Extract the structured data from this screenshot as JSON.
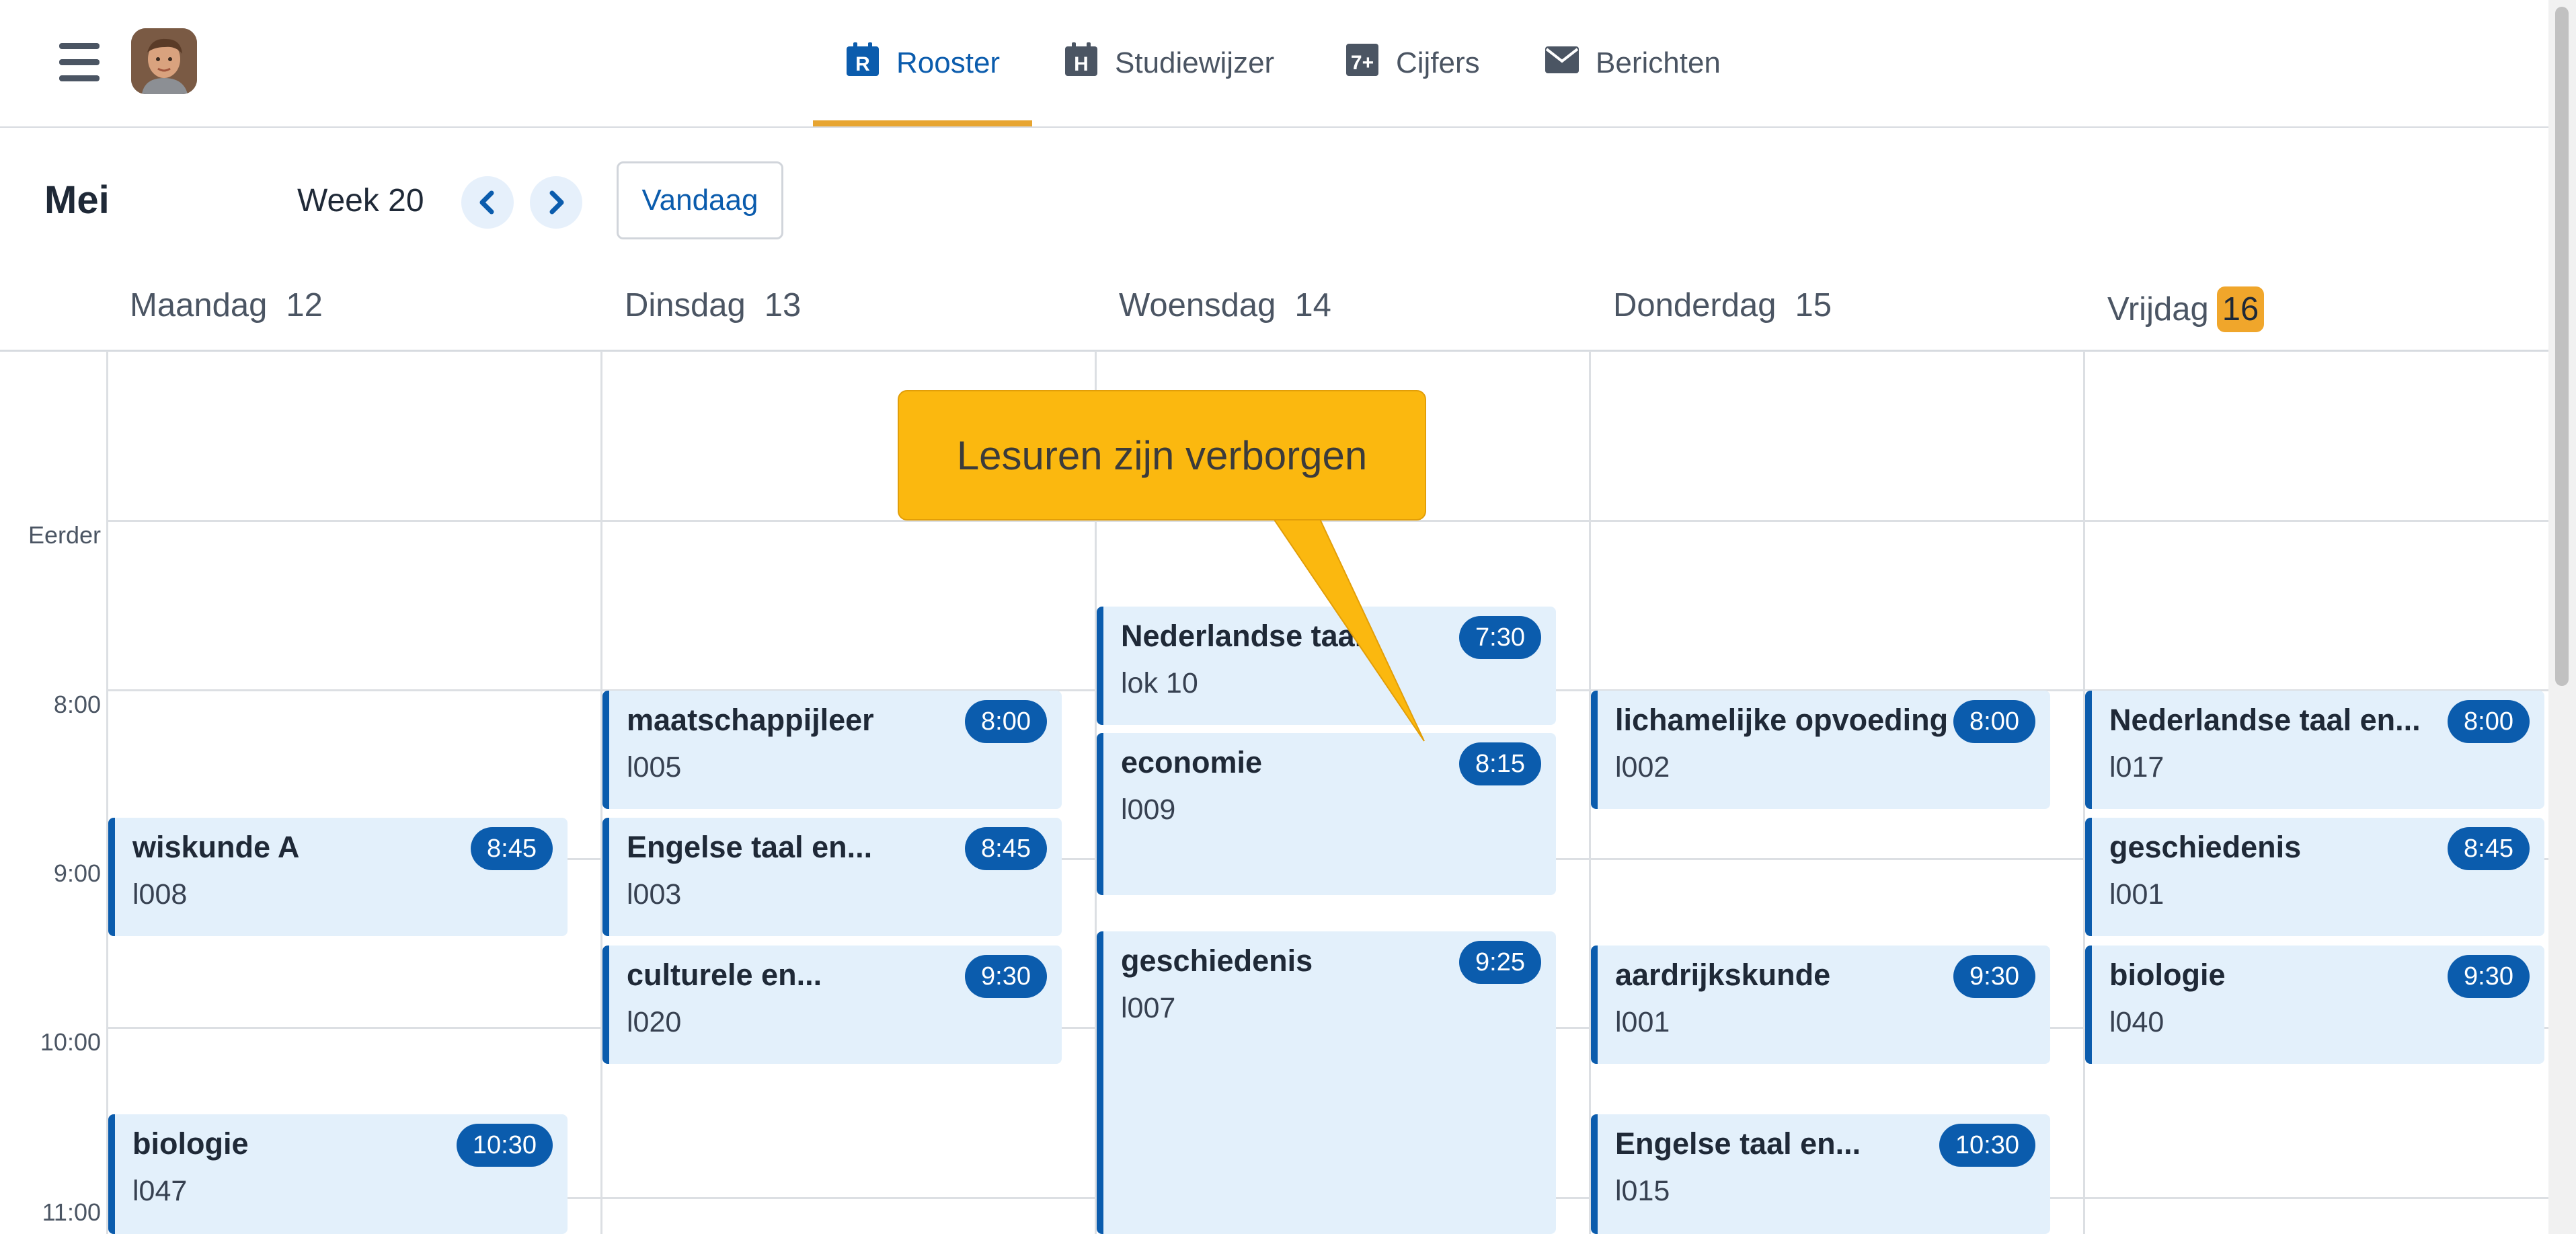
{
  "nav": {
    "tabs": [
      {
        "label": "Rooster",
        "icon": "rooster-icon",
        "active": true
      },
      {
        "label": "Studiewijzer",
        "icon": "studiewijzer-icon",
        "active": false
      },
      {
        "label": "Cijfers",
        "icon": "cijfers-icon",
        "active": false
      },
      {
        "label": "Berichten",
        "icon": "berichten-icon",
        "active": false
      }
    ],
    "rooster_icon_glyph": "R",
    "studiewijzer_icon_glyph": "H",
    "cijfers_icon_glyph": "7+"
  },
  "calendar": {
    "month": "Mei",
    "week": "Week 20",
    "today_button": "Vandaag",
    "days": [
      {
        "name": "Maandag",
        "num": "12"
      },
      {
        "name": "Dinsdag",
        "num": "13"
      },
      {
        "name": "Woensdag",
        "num": "14"
      },
      {
        "name": "Donderdag",
        "num": "15"
      },
      {
        "name": "Vrijdag",
        "num": "16",
        "today": true
      }
    ],
    "time_labels": [
      "Eerder",
      "8:00",
      "9:00",
      "10:00",
      "11:00"
    ],
    "lessons": {
      "mon": [
        {
          "subject": "wiskunde A",
          "room": "l008",
          "time": "8:45"
        },
        {
          "subject": "biologie",
          "room": "l047",
          "time": "10:30"
        }
      ],
      "tue": [
        {
          "subject": "maatschappijleer",
          "room": "l005",
          "time": "8:00"
        },
        {
          "subject": "Engelse taal en...",
          "room": "l003",
          "time": "8:45"
        },
        {
          "subject": "culturele en...",
          "room": "l020",
          "time": "9:30"
        }
      ],
      "wed": [
        {
          "subject": "Nederlandse taal",
          "room": "lok 10",
          "time": "7:30"
        },
        {
          "subject": "economie",
          "room": "l009",
          "time": "8:15"
        },
        {
          "subject": "geschiedenis",
          "room": "l007",
          "time": "9:25"
        }
      ],
      "thu": [
        {
          "subject": "lichamelijke opvoeding",
          "room": "l002",
          "time": "8:00"
        },
        {
          "subject": "aardrijkskunde",
          "room": "l001",
          "time": "9:30"
        },
        {
          "subject": "Engelse taal en...",
          "room": "l015",
          "time": "10:30"
        }
      ],
      "fri": [
        {
          "subject": "Nederlandse taal en...",
          "room": "l017",
          "time": "8:00"
        },
        {
          "subject": "geschiedenis",
          "room": "l001",
          "time": "8:45"
        },
        {
          "subject": "biologie",
          "room": "l040",
          "time": "9:30"
        }
      ]
    }
  },
  "tooltip": {
    "text": "Lesuren zijn verborgen"
  },
  "colors": {
    "accent": "#0b5cad",
    "active_tab_underline": "#e7a531",
    "lesson_bg": "#e3f0fb",
    "today_badge": "#f0a62b",
    "tooltip_bg": "#fbb80f"
  }
}
